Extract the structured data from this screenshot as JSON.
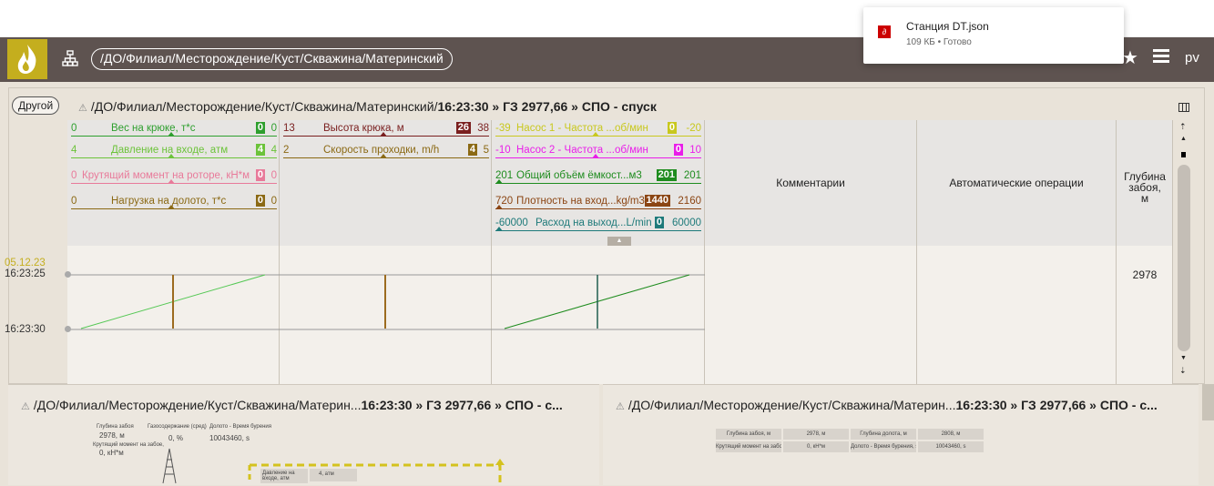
{
  "header": {
    "path": "/ДО/Филиал/Месторождение/Куст/Скважина/Материнский",
    "user": "pv"
  },
  "download": {
    "file_name": "Станция DT.json",
    "file_status": "109 КБ • Готово"
  },
  "panel": {
    "other_button": "Другой",
    "title_path": "/ДО/Филиал/Месторождение/Куст/Скважина/Материнский/",
    "title_bold": "16:23:30 » ГЗ 2977,66 » СПО - спуск"
  },
  "tracks": [
    {
      "gauges": [
        {
          "min": "0",
          "label": "Вес на крюке, т*с",
          "value": "0",
          "max": "0",
          "color": "#2e9f2e"
        },
        {
          "min": "4",
          "label": "Давление на входе, атм",
          "value": "4",
          "max": "4",
          "color": "#6cc33a"
        },
        {
          "min": "0",
          "label": "Крутящий момент на роторе, кН*м",
          "value": "0",
          "max": "0",
          "color": "#e87a9a"
        },
        {
          "min": "0",
          "label": "Нагрузка на долото, т*с",
          "value": "0",
          "max": "0",
          "color": "#8b6914"
        }
      ]
    },
    {
      "gauges": [
        {
          "min": "13",
          "label": "Высота крюка, м",
          "value": "26",
          "max": "38",
          "color": "#7a1f1f"
        },
        {
          "min": "2",
          "label": "Скорость проходки, m/h",
          "value": "4",
          "max": "5",
          "color": "#8b6914"
        }
      ]
    },
    {
      "gauges": [
        {
          "min": "-39",
          "label": "Насос 1 - Частота ...об/мин",
          "value": "0",
          "max": "-20",
          "color": "#c8c81e"
        },
        {
          "min": "-10",
          "label": "Насос 2 - Частота ...об/мин",
          "value": "0",
          "max": "10",
          "color": "#e91ee9"
        },
        {
          "min": "201",
          "label": "Общий объём ёмкост...м3",
          "value": "201",
          "max": "201",
          "color": "#1e8c1e"
        },
        {
          "min": "720",
          "label": "Плотность на вход...kg/m3",
          "value": "1440",
          "max": "2160",
          "color": "#8b4513"
        },
        {
          "min": "-60000",
          "label": "Расход на выход...L/min",
          "value": "0",
          "max": "60000",
          "color": "#1e7a7a"
        }
      ]
    }
  ],
  "columns": {
    "comments": "Комментарии",
    "auto_ops": "Автоматические операции",
    "depth": "Глубина забоя, м",
    "depth_value": "2978"
  },
  "time": {
    "date": "05.12.23",
    "t1": "16:23:25",
    "t2": "16:23:30"
  },
  "bottom": {
    "left_title": "/ДО/Филиал/Месторождение/Куст/Скважина/Материн...",
    "left_bold": "16:23:30 » ГЗ 2977,66 » СПО - с...",
    "right_title": "/ДО/Филиал/Месторождение/Куст/Скважина/Материн...",
    "right_bold": "16:23:30 » ГЗ 2977,66 » СПО - с...",
    "mini": {
      "depth_label": "Глубина забоя",
      "depth_value": "2978, м",
      "gas_label": "Газосодержание (сред)",
      "gas_value": "0, %",
      "bit_label": "Долото - Время бурения",
      "bit_value": "10043460, s",
      "torque_label": "Крутящий момент на забое,",
      "torque_value": "0, кН*м",
      "pressure_label": "Давление на входе, атм",
      "pressure_value": "4, атм"
    },
    "table": [
      [
        "Глубина забоя, м",
        "2978, м",
        "Глубина долота, м",
        "2808, м"
      ],
      [
        "Крутящий момент на забое, кН*м",
        "0, кН*м",
        "Долото - Время бурения, s",
        "10043460, s"
      ]
    ]
  }
}
